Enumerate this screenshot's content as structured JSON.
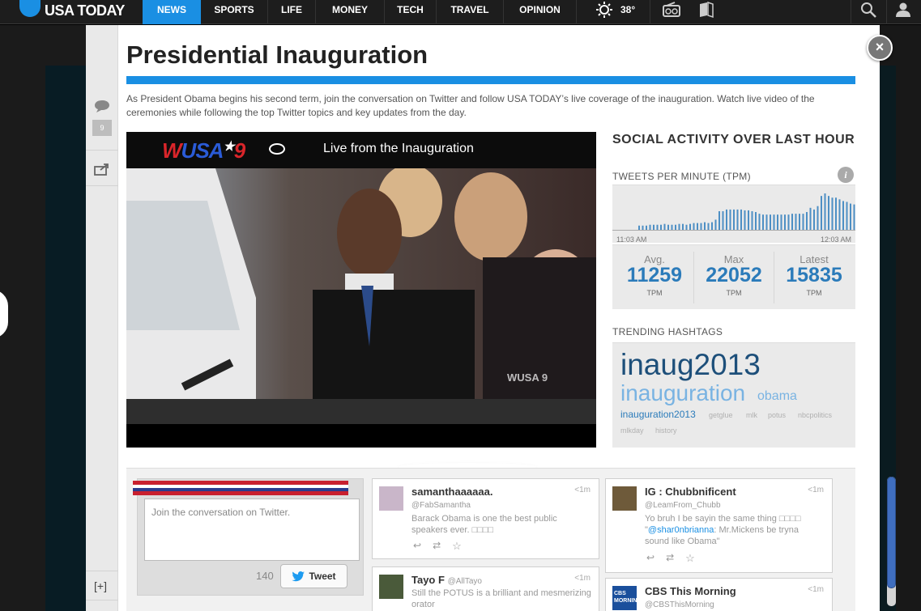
{
  "nav": {
    "logo": "USA TODAY",
    "items": [
      {
        "label": "NEWS",
        "active": true
      },
      {
        "label": "SPORTS"
      },
      {
        "label": "LIFE"
      },
      {
        "label": "MONEY"
      },
      {
        "label": "TECH"
      },
      {
        "label": "TRAVEL"
      },
      {
        "label": "OPINION"
      }
    ],
    "weather_temp": "38°",
    "icons": [
      "sun-icon",
      "radio-icon",
      "ebook-icon",
      "search-icon",
      "user-icon"
    ]
  },
  "utility": {
    "comment_count": "9",
    "expand_label": "[+]"
  },
  "page": {
    "title": "Presidential Inauguration",
    "description": "As President Obama begins his second term, join the conversation on Twitter and follow USA TODAY’s live coverage of the inauguration. Watch live video of the ceremonies while following the top Twitter topics and key updates from the day.",
    "close_label": "×"
  },
  "video": {
    "station_logo": "WUSA★9",
    "title": "Live from the Inauguration",
    "watermark": "WUSA 9"
  },
  "social": {
    "title": "SOCIAL ACTIVITY OVER LAST HOUR",
    "tpm_label": "TWEETS PER MINUTE (TPM)",
    "chart_start": "11:03 AM",
    "chart_end": "12:03 AM",
    "stats": [
      {
        "label": "Avg.",
        "value": "11259",
        "unit": "TPM"
      },
      {
        "label": "Max",
        "value": "22052",
        "unit": "TPM"
      },
      {
        "label": "Latest",
        "value": "15835",
        "unit": "TPM"
      }
    ],
    "trending_label": "TRENDING HASHTAGS",
    "hashtags": [
      {
        "text": "inaug2013",
        "color": "#1d4f7a"
      },
      {
        "text": "inauguration",
        "color": "#79b3e2"
      },
      {
        "text": "obama",
        "color": "#79b3e2"
      },
      {
        "text": "inauguration2013",
        "color": "#2b7bba"
      },
      {
        "text": "getglue",
        "color": "#b0b0b0"
      },
      {
        "text": "mlk",
        "color": "#b0b0b0"
      },
      {
        "text": "potus",
        "color": "#b0b0b0"
      },
      {
        "text": "nbcpolitics",
        "color": "#b0b0b0"
      },
      {
        "text": "mlkday",
        "color": "#b0b0b0"
      },
      {
        "text": "history",
        "color": "#b0b0b0"
      }
    ]
  },
  "compose": {
    "placeholder": "Join the conversation on Twitter.",
    "char_count": "140",
    "tweet_label": "Tweet"
  },
  "tweets": [
    {
      "name": "samanthaaaaaa.",
      "handle": "@FabSamantha",
      "time": "<1m",
      "text": "Barack Obama is one the best public speakers ever. □□□□"
    },
    {
      "name": "IG : Chubbnificent",
      "handle": "@LeamFrom_Chubb",
      "time": "<1m",
      "text_before": "Yo bruh I be sayin the same thing □□□□ \"",
      "mention": "@shar0nbrianna",
      "text_after": ": Mr.Mickens be tryna sound like Obama\""
    },
    {
      "name": "Tayo F",
      "handle": "@AllTayo",
      "time": "<1m",
      "text": "Still the POTUS is a brilliant and mesmerizing orator"
    },
    {
      "name": "CBS This Morning",
      "handle": "@CBSThisMorning",
      "time": "<1m",
      "avatar_text": "CBS MORNING"
    }
  ],
  "chart_data": {
    "type": "bar",
    "title": "TWEETS PER MINUTE (TPM)",
    "x_start": "11:03 AM",
    "x_end": "12:03 AM",
    "values": [
      5,
      5,
      5,
      6,
      6,
      6,
      6,
      7,
      6,
      6,
      6,
      7,
      7,
      6,
      7,
      8,
      8,
      8,
      9,
      8,
      9,
      12,
      22,
      22,
      24,
      24,
      24,
      24,
      24,
      23,
      23,
      22,
      21,
      19,
      18,
      18,
      18,
      18,
      18,
      18,
      18,
      18,
      19,
      19,
      19,
      19,
      21,
      26,
      24,
      28,
      40,
      43,
      40,
      38,
      38,
      36,
      34,
      33,
      31,
      30
    ]
  }
}
